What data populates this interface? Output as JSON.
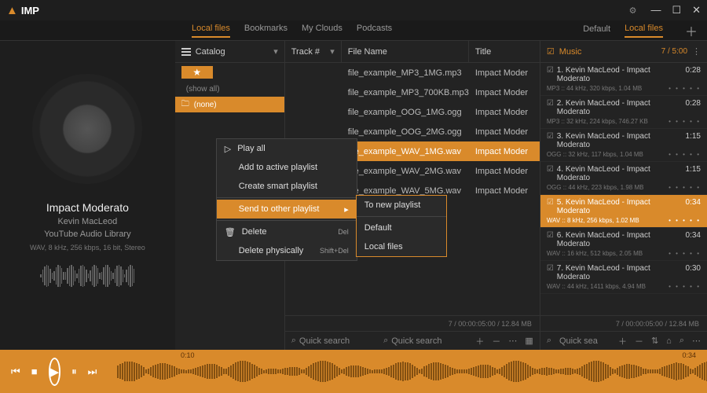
{
  "app": {
    "name": "IMP"
  },
  "window": {
    "minimize": "—",
    "maximize": "☐",
    "close": "✕"
  },
  "tabs_left": [
    "Local files",
    "Bookmarks",
    "My Clouds",
    "Podcasts"
  ],
  "tabs_left_active": 0,
  "tabs_right": [
    "Default",
    "Local files"
  ],
  "tabs_right_active": 1,
  "now_playing": {
    "title": "Impact Moderato",
    "artist": "Kevin MacLeod",
    "album": "YouTube Audio Library",
    "meta": "WAV, 8 kHz, 256 kbps, 16 bit, Stereo"
  },
  "catalog": {
    "header": "Catalog",
    "show_all": "(show all)",
    "none": "(none)"
  },
  "file_headers": {
    "track": "Track #",
    "name": "File Name",
    "title": "Title"
  },
  "files": [
    {
      "name": "file_example_MP3_1MG.mp3",
      "title": "Impact Moder"
    },
    {
      "name": "file_example_MP3_700KB.mp3",
      "title": "Impact Moder"
    },
    {
      "name": "file_example_OOG_1MG.ogg",
      "title": "Impact Moder"
    },
    {
      "name": "file_example_OOG_2MG.ogg",
      "title": "Impact Moder"
    },
    {
      "name": "file_example_WAV_1MG.wav",
      "title": "Impact Moder",
      "selected": true
    },
    {
      "name": "file_example_WAV_2MG.wav",
      "title": "Impact Moder"
    },
    {
      "name": "file_example_WAV_5MG.wav",
      "title": "Impact Moder"
    }
  ],
  "context_menu": {
    "play_all": "Play all",
    "add_active": "Add to active playlist",
    "create_smart": "Create smart playlist",
    "send_other": "Send to other playlist",
    "delete": "Delete",
    "delete_key": "Del",
    "delete_phys": "Delete physically",
    "delete_phys_key": "Shift+Del"
  },
  "submenu": {
    "new_playlist": "To new playlist",
    "default": "Default",
    "local_files": "Local files"
  },
  "playlist": {
    "header": "Music",
    "count": "7 / 5:00",
    "items": [
      {
        "n": "1.",
        "title": "Kevin MacLeod - Impact Moderato",
        "dur": "0:28",
        "meta": "MP3 :: 44 kHz, 320 kbps, 1.04 MB"
      },
      {
        "n": "2.",
        "title": "Kevin MacLeod - Impact Moderato",
        "dur": "0:28",
        "meta": "MP3 :: 32 kHz, 224 kbps, 746.27 KB"
      },
      {
        "n": "3.",
        "title": "Kevin MacLeod - Impact Moderato",
        "dur": "1:15",
        "meta": "OGG :: 32 kHz, 117 kbps, 1.04 MB"
      },
      {
        "n": "4.",
        "title": "Kevin MacLeod - Impact Moderato",
        "dur": "1:15",
        "meta": "OGG :: 44 kHz, 223 kbps, 1.98 MB"
      },
      {
        "n": "5.",
        "title": "Kevin MacLeod - Impact Moderato",
        "dur": "0:34",
        "meta": "WAV :: 8 kHz, 256 kbps, 1.02 MB",
        "selected": true
      },
      {
        "n": "6.",
        "title": "Kevin MacLeod - Impact Moderato",
        "dur": "0:34",
        "meta": "WAV :: 16 kHz, 512 kbps, 2.05 MB"
      },
      {
        "n": "7.",
        "title": "Kevin MacLeod - Impact Moderato",
        "dur": "0:30",
        "meta": "WAV :: 44 kHz, 1411 kbps, 4.94 MB"
      }
    ]
  },
  "status": "7 / 00:00:05:00 / 12.84 MB",
  "quick_search": "Quick search",
  "playbar": {
    "pos": "0:10",
    "dur": "0:34"
  }
}
